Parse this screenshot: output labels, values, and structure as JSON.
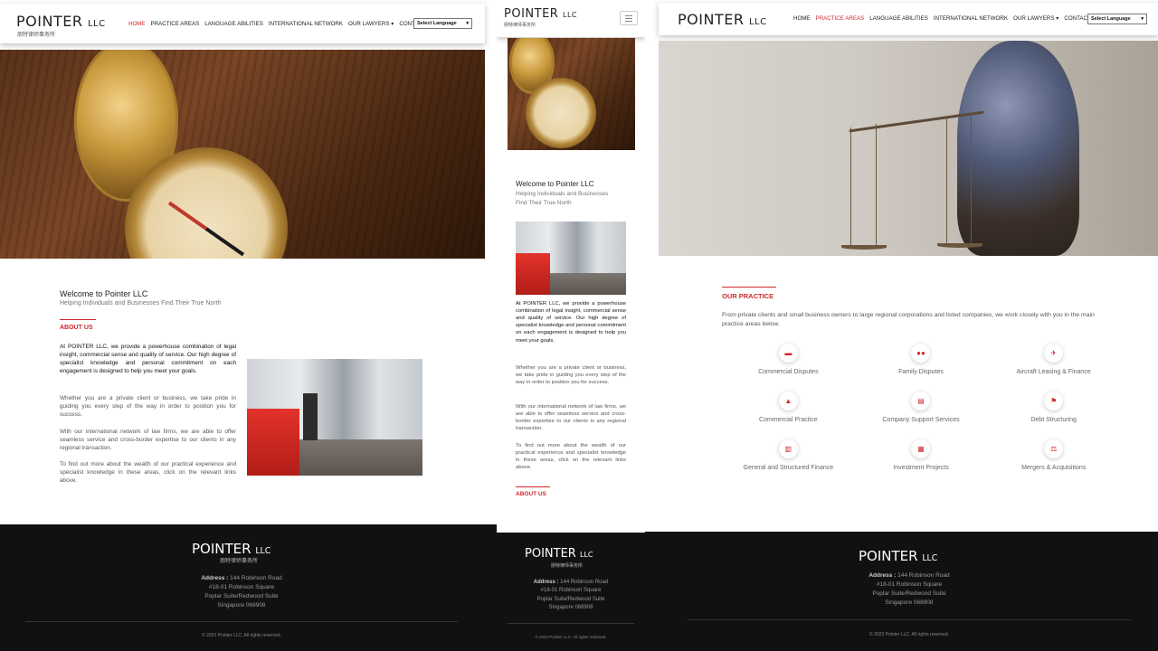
{
  "brand": {
    "name": "POINTER",
    "suffix": "LLC",
    "chinese": "朋特律师事务所"
  },
  "nav": {
    "items": [
      "HOME",
      "PRACTICE AREAS",
      "LANGUAGE ABILITIES",
      "INTERNATIONAL NETWORK",
      "OUR LAWYERS ▾",
      "CONTACT"
    ],
    "language_select": "Select Language"
  },
  "home": {
    "welcome_title": "Welcome to Pointer LLC",
    "welcome_subtitle": "Helping Individuals and Businesses Find Their True North",
    "about_title": "ABOUT US",
    "paragraphs": [
      "At POINTER LLC, we provide a powerhouse combination of legal insight, commercial sense and quality of service. Our high degree of specialist knowledge and personal commitment on each engagement is designed to help you meet your goals.",
      "Whether you are a private client or business, we take pride in guiding you every step of the way in order to position you for success.",
      "With our international network of law firms, we are able to offer seamless service and cross-border expertise to our clients in any regional transaction.",
      "To find out more about the wealth of our practical experience and specialist knowledge in these areas, click on the relevant links above."
    ]
  },
  "mobile": {
    "welcome_subtitle_line1": "Helping Individuals and Businesses",
    "welcome_subtitle_line2": "Find Their True North"
  },
  "practice": {
    "title": "OUR PRACTICE",
    "intro": "From private clients and small business owners to large regional corporations and listed companies, we work closely with you in the main practice areas below.",
    "areas": [
      {
        "label": "Commercial Disputes",
        "icon": "briefcase-icon",
        "glyph": "▬"
      },
      {
        "label": "Family Disputes",
        "icon": "people-icon",
        "glyph": "●●"
      },
      {
        "label": "Aircraft Leasing & Finance",
        "icon": "rocket-icon",
        "glyph": "✈"
      },
      {
        "label": "Commercial Practice",
        "icon": "handshake-icon",
        "glyph": "▲"
      },
      {
        "label": "Company Support Services",
        "icon": "building-icon",
        "glyph": "▤"
      },
      {
        "label": "Debt Structuring",
        "icon": "flag-icon",
        "glyph": "⚑"
      },
      {
        "label": "General and Structured Finance",
        "icon": "chart-icon",
        "glyph": "▥"
      },
      {
        "label": "Investment Projects",
        "icon": "money-icon",
        "glyph": "▦"
      },
      {
        "label": "Mergers & Acquisitions",
        "icon": "merge-icon",
        "glyph": "⚖"
      }
    ]
  },
  "footer": {
    "address_label": "Address :",
    "address_lines": [
      "144 Robinson Road",
      "#18-01 Robinson Square",
      "Poplar Suite/Redwood Suite",
      "Singapore 068908"
    ],
    "copyright": "© 2022 Pointer LLC. All rights reserved."
  },
  "colors": {
    "accent": "#d0282d",
    "footer_bg": "#111111"
  }
}
